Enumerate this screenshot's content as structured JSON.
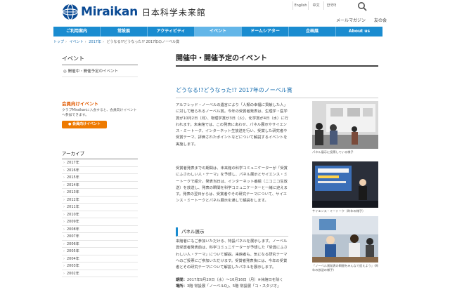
{
  "header": {
    "logo_text": "Miraikan",
    "logo_jp": "日本科学未来館",
    "languages": [
      "English",
      "中文",
      "한국어"
    ],
    "sub_links": [
      "メールマガジン",
      "友の会"
    ]
  },
  "nav": {
    "items": [
      "ご利用案内",
      "常設展",
      "アクティビティ",
      "イベント",
      "ドームシアター",
      "企画展",
      "About us"
    ],
    "active_index": 3
  },
  "breadcrumb": [
    "トップ",
    "イベント",
    "2017年",
    "どうなる!?どうなった!? 2017年のノーベル賞"
  ],
  "sidebar": {
    "title": "イベント",
    "link": "開催中・開催予定のイベント",
    "member_title": "会員向けイベント",
    "member_desc": "クラブMiraikanに入会すると、会員向けイベントへ参加できます。",
    "member_button": "会員向けイベント",
    "archive_title": "アーカイブ",
    "archive_years": [
      "2017年",
      "2016年",
      "2015年",
      "2014年",
      "2013年",
      "2012年",
      "2011年",
      "2010年",
      "2009年",
      "2008年",
      "2007年",
      "2006年",
      "2005年",
      "2004年",
      "2003年",
      "2002年"
    ]
  },
  "main": {
    "title": "開催中・開催予定のイベント",
    "event_title": "どうなる!?どうなった!? 2017年のノーベル賞",
    "p1": "アルフレッド・ノーベルの遺言により「人類の幸福に貢献した人」に対して贈られるノーベル賞。今年の受賞者発表は、生理学・医学賞が10月2日（月）、物理学賞が3日（火）、化学賞が4日（水）に行われます。未来館では、この発表にあわせ、パネル展示やサイエンス・ミートーク、インターネット生放送を行い、受賞した研究者や受賞テーマ、評価されたポイントなどについて解説するイベントを実施します。",
    "p2": "受賞者発表までの期間は、未来館の科学コミュニケーターが「受賞にふさわしい人・テーマ」を予想し、パネル展示とサイエンス・ミートークで紹介。発表当日は、インターネット番組（ニコニコ生放送）を放送し、発表の瞬間を科学コミュニケーターと一緒に迎えます。発表の翌日からは、受賞者やその研究テーマについて、サイエンス・ミートークとパネル展示を通して解説をします。",
    "section_heading": "パネル展示",
    "p3": "来館者にもご参加いただける、特設パネルを展示します。ノーベル賞受賞者発表前は、科学コミュニケーターが予想した「受賞にふさわしい人・テーマ」について解説。来館者も、気になる研究テーマへのご投票にご参加いただけます。受賞者発表後には、今年の受賞者とその研究テーマについて解説したパネルを展示します。",
    "date_label": "期間：",
    "date_value": "2017年9月20日（水）〜10月16日（月）※休館日を除く",
    "place_label": "場所：",
    "place_value": "3階 常設展「ノーベルQ」、5階 常設展「コ・スタジオ」"
  },
  "photos": {
    "caption1": "パネル展示に投票している様子",
    "caption2": "サイエンス・ミートーク（昨年の様子）",
    "caption3": "「ノーベル賞発表の瞬間をみんなで迎えよう」（昨年の放送の様子）"
  }
}
